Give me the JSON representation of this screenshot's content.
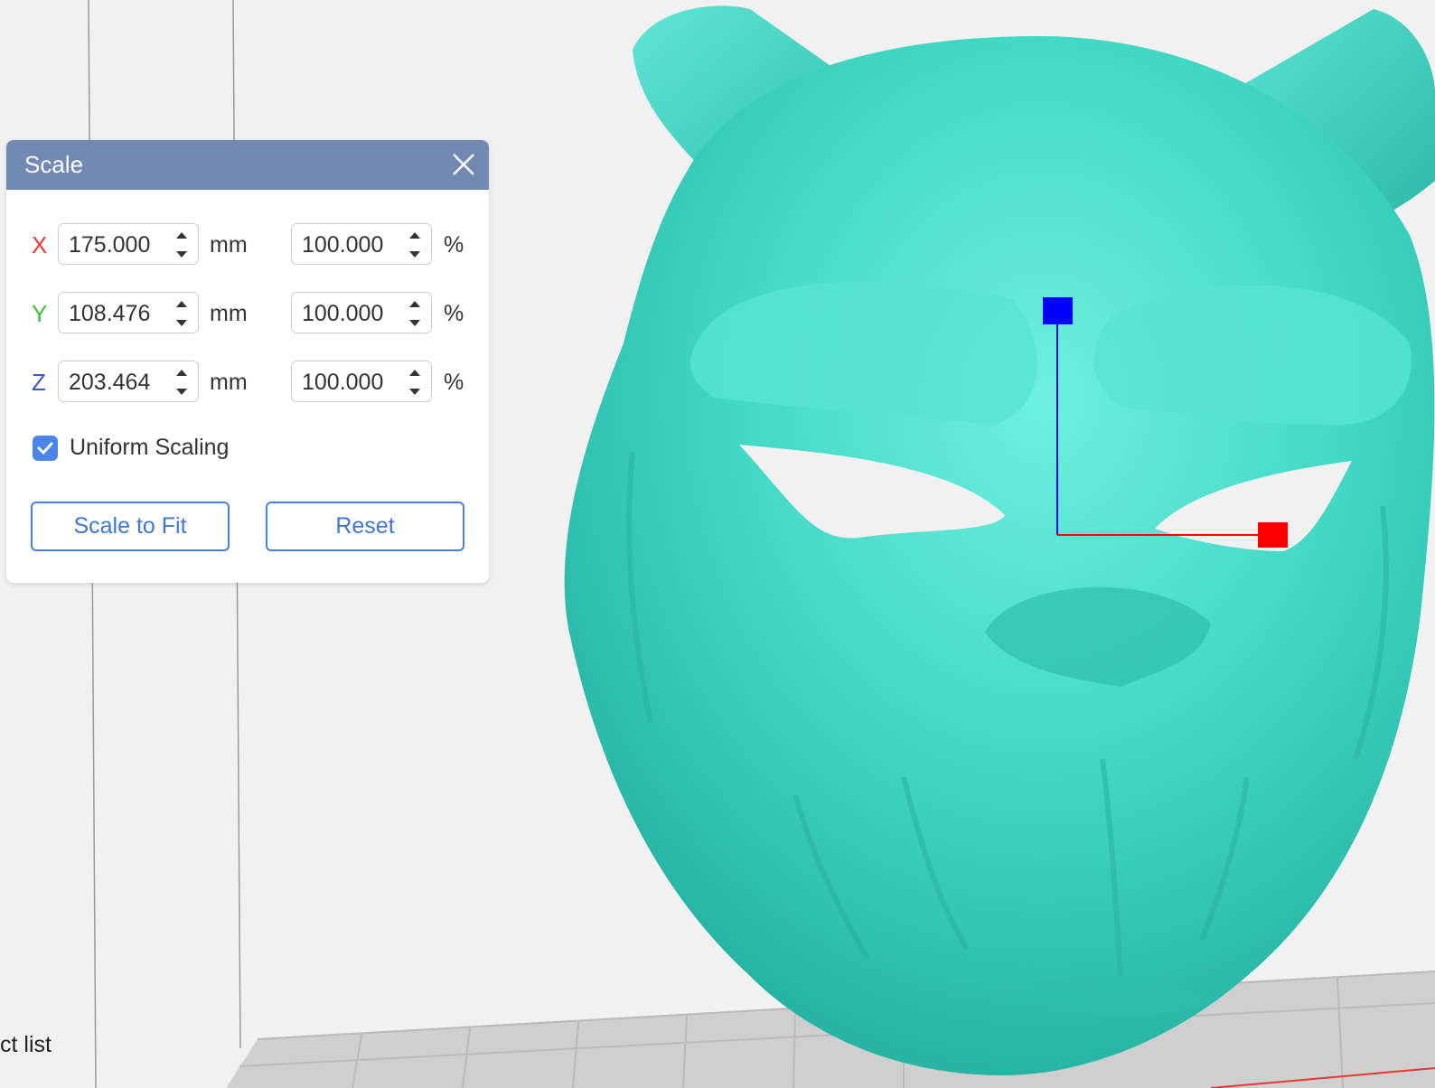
{
  "scale_panel": {
    "title": "Scale",
    "rows": [
      {
        "axis": "X",
        "axis_color": "#e53b3b",
        "size_value": "175.000",
        "size_unit": "mm",
        "percent_value": "100.000",
        "percent_unit": "%"
      },
      {
        "axis": "Y",
        "axis_color": "#3fbf3f",
        "size_value": "108.476",
        "size_unit": "mm",
        "percent_value": "100.000",
        "percent_unit": "%"
      },
      {
        "axis": "Z",
        "axis_color": "#3b57c9",
        "size_value": "203.464",
        "size_unit": "mm",
        "percent_value": "100.000",
        "percent_unit": "%"
      }
    ],
    "uniform_scaling": {
      "label": "Uniform Scaling",
      "checked": true
    },
    "scale_to_fit_label": "Scale to Fit",
    "reset_label": "Reset"
  },
  "sidebar": {
    "object_list_label": "ct list"
  },
  "model": {
    "color": "#3fd6c4",
    "gizmo_z_color": "#0000ff",
    "gizmo_x_color": "#ff0000"
  }
}
